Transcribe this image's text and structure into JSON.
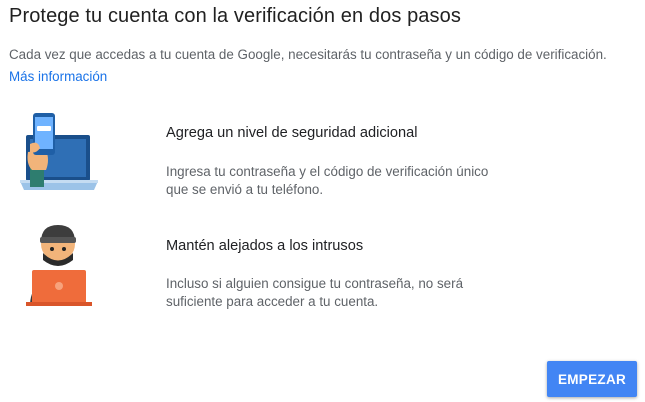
{
  "header": {
    "title": "Protege tu cuenta con la verificación en dos pasos"
  },
  "intro": {
    "text": "Cada vez que accedas a tu cuenta de Google, necesitarás tu contraseña y un código de verificación.",
    "link_label": "Más información"
  },
  "features": [
    {
      "icon": "phone-laptop-illustration",
      "title": "Agrega un nivel de seguridad adicional",
      "description_line1": "Ingresa tu contraseña y el código de verificación único",
      "description_line2": "que se envió a tu teléfono."
    },
    {
      "icon": "intruder-illustration",
      "title": "Mantén alejados a los intrusos",
      "description_line1": "Incluso si alguien consigue tu contraseña, no será",
      "description_line2": "suficiente para acceder a tu cuenta."
    }
  ],
  "actions": {
    "start_label": "EMPEZAR"
  },
  "colors": {
    "accent": "#4285f4",
    "link": "#1a73e8"
  }
}
